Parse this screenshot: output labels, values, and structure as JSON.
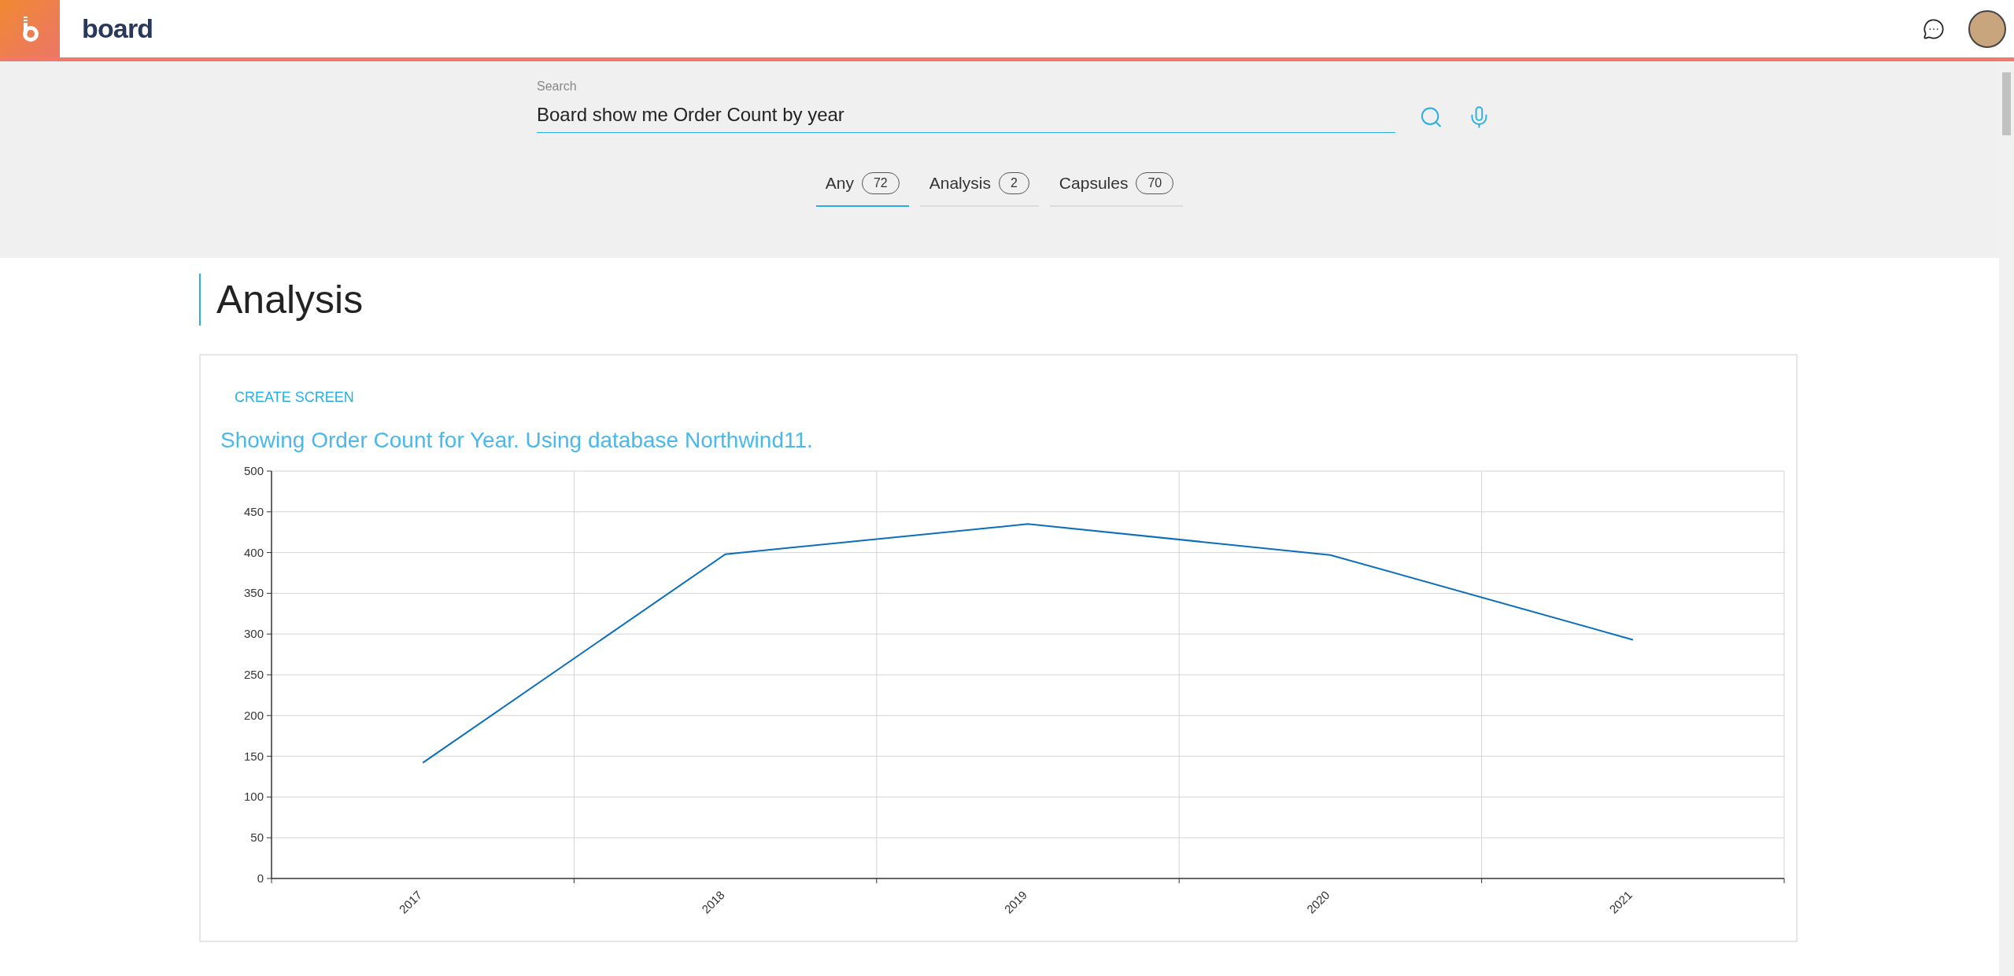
{
  "header": {
    "logo": "board"
  },
  "search": {
    "label": "Search",
    "value": "Board show me Order Count by year"
  },
  "tabs": [
    {
      "label": "Any",
      "count": "72",
      "selected": true
    },
    {
      "label": "Analysis",
      "count": "2",
      "selected": false
    },
    {
      "label": "Capsules",
      "count": "70",
      "selected": false
    }
  ],
  "section": {
    "title": "Analysis"
  },
  "card": {
    "action": "CREATE SCREEN",
    "description": "Showing Order Count for Year. Using database Northwind11.",
    "chart_data": {
      "type": "line",
      "categories": [
        "2017",
        "2018",
        "2019",
        "2020",
        "2021"
      ],
      "series": [
        {
          "color": "#0a6ebd",
          "values": [
            142,
            398,
            435,
            397,
            293
          ]
        }
      ],
      "grid": true,
      "ylim": [
        0,
        500
      ],
      "yticks": [
        0,
        50,
        100,
        150,
        200,
        250,
        300,
        350,
        400,
        450,
        500
      ]
    }
  }
}
